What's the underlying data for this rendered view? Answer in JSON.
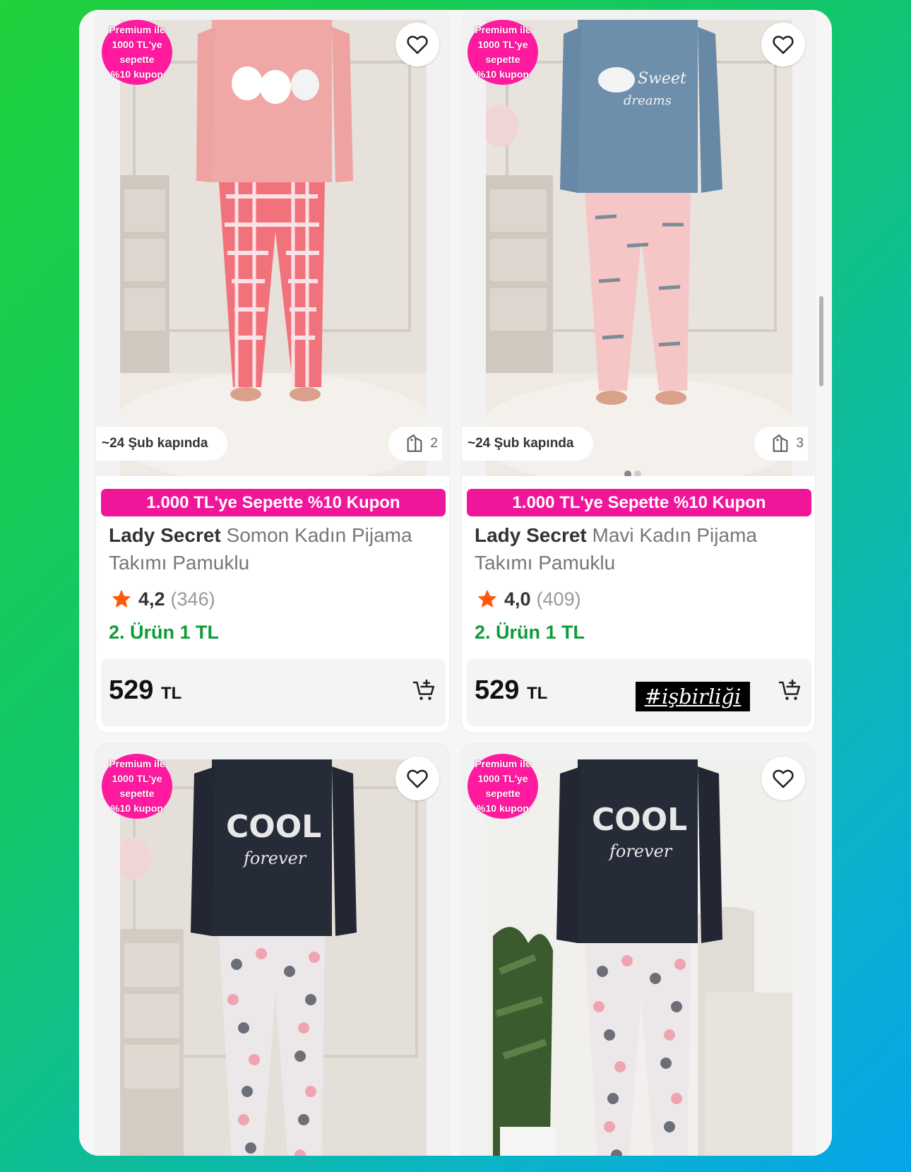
{
  "screen": {
    "accent": "#f0169a",
    "promo_color": "#0e9c3a"
  },
  "products": [
    {
      "premium_badge": "Premium ile\n1000 TL'ye\nsepette\n%10 kupon",
      "delivery": "~24 Şub kapında",
      "variant_count": "2",
      "coupon": "1.000 TL'ye Sepette %10 Kupon",
      "brand": "Lady Secret",
      "name": "Somon Kadın Pijama Takımı Pamuklu",
      "rating": "4,2",
      "rating_count": "(346)",
      "promo": "2. Ürün 1 TL",
      "price": "529",
      "currency": "TL"
    },
    {
      "premium_badge": "Premium ile\n1000 TL'ye\nsepette\n%10 kupon",
      "delivery": "~24 Şub kapında",
      "variant_count": "3",
      "coupon": "1.000 TL'ye Sepette %10 Kupon",
      "brand": "Lady Secret",
      "name": "Mavi Kadın Pijama Takımı Pamuklu",
      "rating": "4,0",
      "rating_count": "(409)",
      "promo": "2. Ürün 1 TL",
      "price": "529",
      "currency": "TL"
    },
    {
      "premium_badge": "Premium ile\n1000 TL'ye\nsepette\n%10 kupon"
    },
    {
      "premium_badge": "Premium ile\n1000 TL'ye\nsepette\n%10 kupon"
    }
  ],
  "overlay": {
    "collab_tag": "#işbirliği"
  },
  "icons": {
    "favorite": "heart-outline-icon",
    "cart": "add-to-cart-icon",
    "variants": "tag-icon",
    "rating": "star-icon"
  }
}
